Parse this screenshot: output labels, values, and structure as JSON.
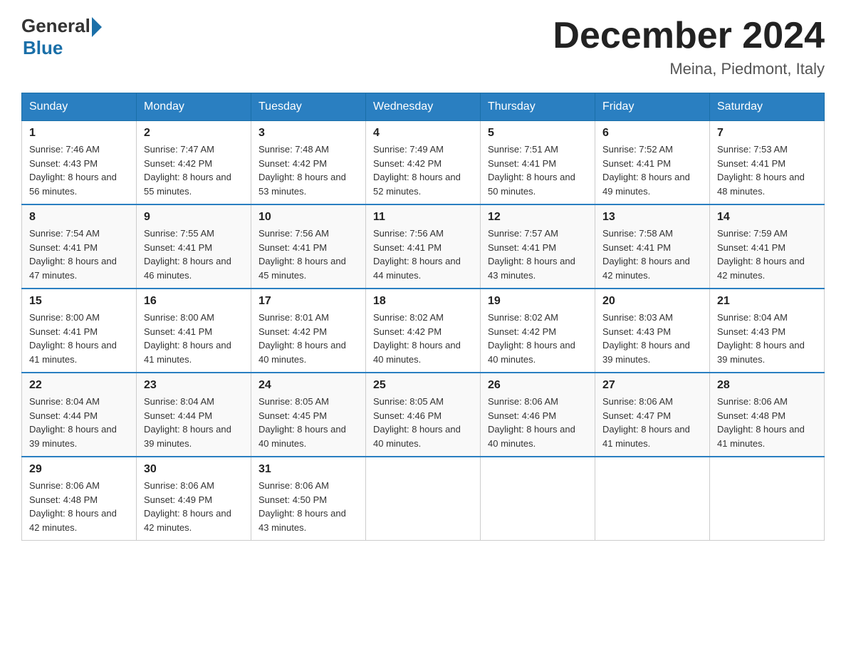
{
  "header": {
    "logo_general": "General",
    "logo_blue": "Blue",
    "month_title": "December 2024",
    "location": "Meina, Piedmont, Italy"
  },
  "days_of_week": [
    "Sunday",
    "Monday",
    "Tuesday",
    "Wednesday",
    "Thursday",
    "Friday",
    "Saturday"
  ],
  "weeks": [
    [
      {
        "day": "1",
        "sunrise": "7:46 AM",
        "sunset": "4:43 PM",
        "daylight": "8 hours and 56 minutes."
      },
      {
        "day": "2",
        "sunrise": "7:47 AM",
        "sunset": "4:42 PM",
        "daylight": "8 hours and 55 minutes."
      },
      {
        "day": "3",
        "sunrise": "7:48 AM",
        "sunset": "4:42 PM",
        "daylight": "8 hours and 53 minutes."
      },
      {
        "day": "4",
        "sunrise": "7:49 AM",
        "sunset": "4:42 PM",
        "daylight": "8 hours and 52 minutes."
      },
      {
        "day": "5",
        "sunrise": "7:51 AM",
        "sunset": "4:41 PM",
        "daylight": "8 hours and 50 minutes."
      },
      {
        "day": "6",
        "sunrise": "7:52 AM",
        "sunset": "4:41 PM",
        "daylight": "8 hours and 49 minutes."
      },
      {
        "day": "7",
        "sunrise": "7:53 AM",
        "sunset": "4:41 PM",
        "daylight": "8 hours and 48 minutes."
      }
    ],
    [
      {
        "day": "8",
        "sunrise": "7:54 AM",
        "sunset": "4:41 PM",
        "daylight": "8 hours and 47 minutes."
      },
      {
        "day": "9",
        "sunrise": "7:55 AM",
        "sunset": "4:41 PM",
        "daylight": "8 hours and 46 minutes."
      },
      {
        "day": "10",
        "sunrise": "7:56 AM",
        "sunset": "4:41 PM",
        "daylight": "8 hours and 45 minutes."
      },
      {
        "day": "11",
        "sunrise": "7:56 AM",
        "sunset": "4:41 PM",
        "daylight": "8 hours and 44 minutes."
      },
      {
        "day": "12",
        "sunrise": "7:57 AM",
        "sunset": "4:41 PM",
        "daylight": "8 hours and 43 minutes."
      },
      {
        "day": "13",
        "sunrise": "7:58 AM",
        "sunset": "4:41 PM",
        "daylight": "8 hours and 42 minutes."
      },
      {
        "day": "14",
        "sunrise": "7:59 AM",
        "sunset": "4:41 PM",
        "daylight": "8 hours and 42 minutes."
      }
    ],
    [
      {
        "day": "15",
        "sunrise": "8:00 AM",
        "sunset": "4:41 PM",
        "daylight": "8 hours and 41 minutes."
      },
      {
        "day": "16",
        "sunrise": "8:00 AM",
        "sunset": "4:41 PM",
        "daylight": "8 hours and 41 minutes."
      },
      {
        "day": "17",
        "sunrise": "8:01 AM",
        "sunset": "4:42 PM",
        "daylight": "8 hours and 40 minutes."
      },
      {
        "day": "18",
        "sunrise": "8:02 AM",
        "sunset": "4:42 PM",
        "daylight": "8 hours and 40 minutes."
      },
      {
        "day": "19",
        "sunrise": "8:02 AM",
        "sunset": "4:42 PM",
        "daylight": "8 hours and 40 minutes."
      },
      {
        "day": "20",
        "sunrise": "8:03 AM",
        "sunset": "4:43 PM",
        "daylight": "8 hours and 39 minutes."
      },
      {
        "day": "21",
        "sunrise": "8:04 AM",
        "sunset": "4:43 PM",
        "daylight": "8 hours and 39 minutes."
      }
    ],
    [
      {
        "day": "22",
        "sunrise": "8:04 AM",
        "sunset": "4:44 PM",
        "daylight": "8 hours and 39 minutes."
      },
      {
        "day": "23",
        "sunrise": "8:04 AM",
        "sunset": "4:44 PM",
        "daylight": "8 hours and 39 minutes."
      },
      {
        "day": "24",
        "sunrise": "8:05 AM",
        "sunset": "4:45 PM",
        "daylight": "8 hours and 40 minutes."
      },
      {
        "day": "25",
        "sunrise": "8:05 AM",
        "sunset": "4:46 PM",
        "daylight": "8 hours and 40 minutes."
      },
      {
        "day": "26",
        "sunrise": "8:06 AM",
        "sunset": "4:46 PM",
        "daylight": "8 hours and 40 minutes."
      },
      {
        "day": "27",
        "sunrise": "8:06 AM",
        "sunset": "4:47 PM",
        "daylight": "8 hours and 41 minutes."
      },
      {
        "day": "28",
        "sunrise": "8:06 AM",
        "sunset": "4:48 PM",
        "daylight": "8 hours and 41 minutes."
      }
    ],
    [
      {
        "day": "29",
        "sunrise": "8:06 AM",
        "sunset": "4:48 PM",
        "daylight": "8 hours and 42 minutes."
      },
      {
        "day": "30",
        "sunrise": "8:06 AM",
        "sunset": "4:49 PM",
        "daylight": "8 hours and 42 minutes."
      },
      {
        "day": "31",
        "sunrise": "8:06 AM",
        "sunset": "4:50 PM",
        "daylight": "8 hours and 43 minutes."
      },
      null,
      null,
      null,
      null
    ]
  ]
}
